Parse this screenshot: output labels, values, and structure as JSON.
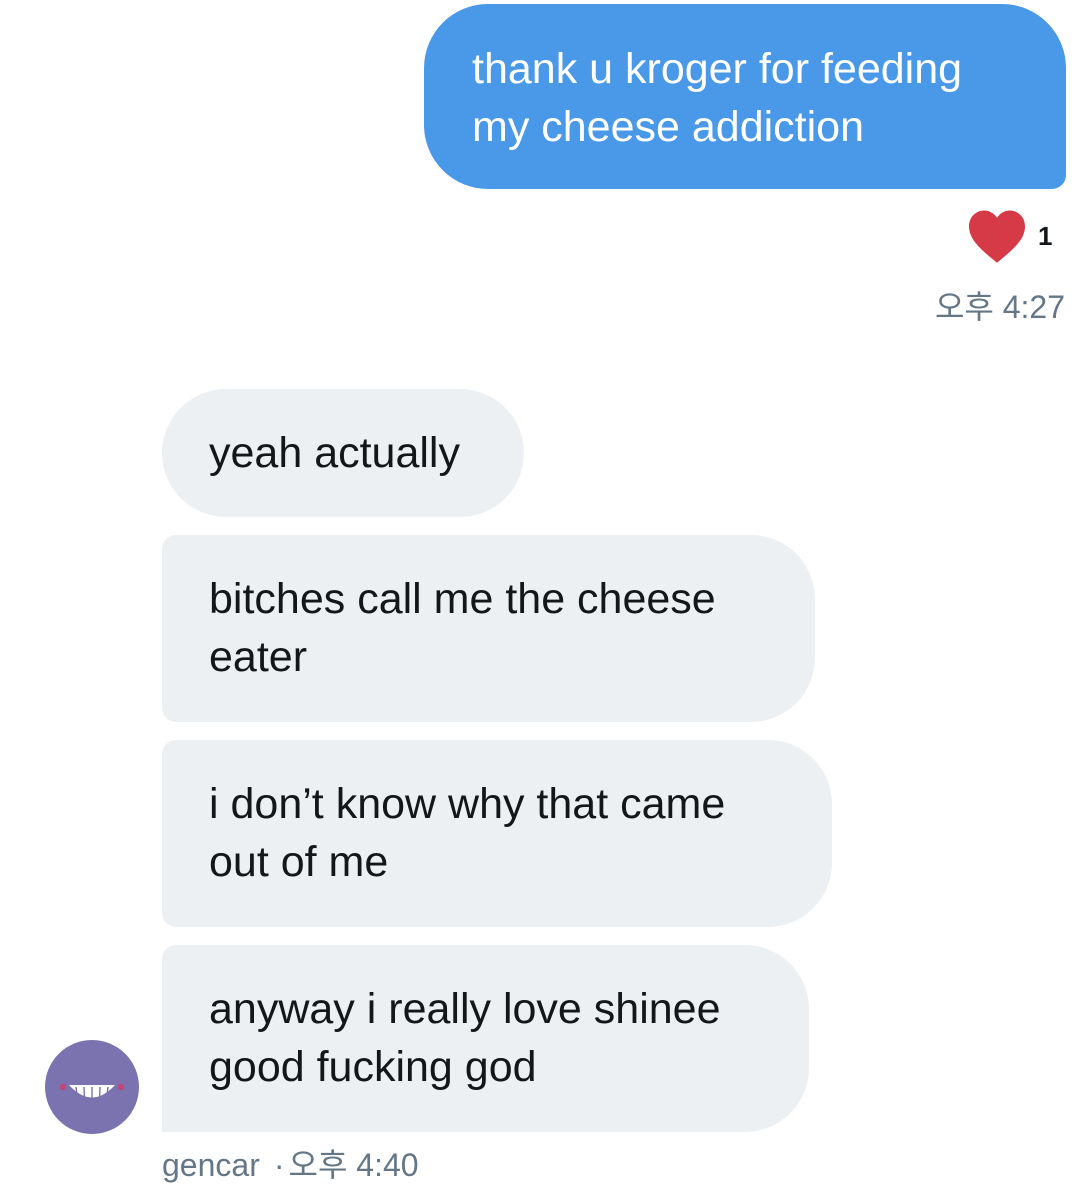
{
  "sent_message": {
    "text": "thank u kroger for feeding\nmy cheese addiction",
    "reaction_icon": "heart-icon",
    "reaction_count": "1",
    "timestamp": "오후 4:27"
  },
  "received_messages": [
    {
      "text": "yeah actually"
    },
    {
      "text": "bitches call me the cheese\neater"
    },
    {
      "text": "i don’t know why that came\nout of me"
    },
    {
      "text": "anyway i really love shinee\ngood fucking god"
    }
  ],
  "sender": {
    "name": "gencar",
    "separator": "·",
    "timestamp": "오후 4:40",
    "avatar_icon": "grinning-face-avatar"
  },
  "colors": {
    "sent_bubble": "#4a99e9",
    "received_bubble": "#edf0f2",
    "heart": "#d63a46",
    "timestamp_text": "#657786",
    "avatar_bg": "#7a73b0"
  }
}
